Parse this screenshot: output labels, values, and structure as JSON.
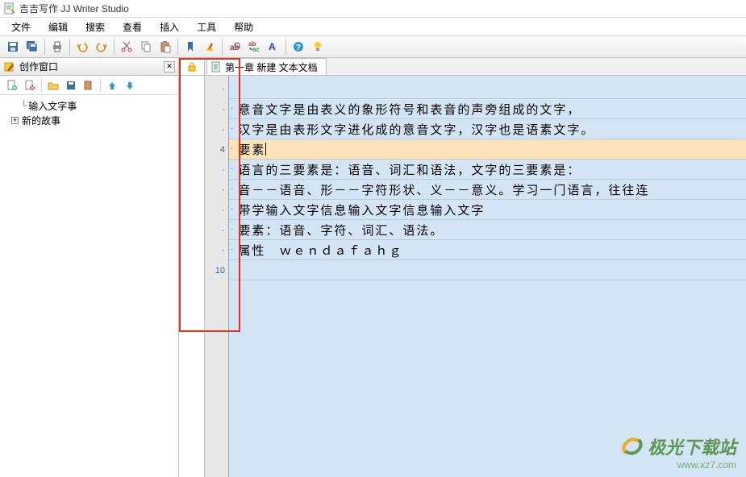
{
  "app": {
    "title": "吉吉写作 JJ Writer Studio"
  },
  "menus": [
    "文件",
    "编辑",
    "搜索",
    "查看",
    "插入",
    "工具",
    "帮助"
  ],
  "sidebar": {
    "title": "创作窗口",
    "tree": {
      "item1": "输入文字事",
      "item2": "新的故事"
    }
  },
  "tab": {
    "title": "第一章 新建 文本文档"
  },
  "editor": {
    "lines": [
      "",
      "意音文字是由表义的象形符号和表音的声旁组成的文字，",
      "汉字是由表形文字进化成的意音文字，汉字也是语素文字。",
      "要素",
      "语言的三要素是：语音、词汇和语法，文字的三要素是：",
      "音－－语音、形－－字符形状、义－－意义。学习一门语言，往往连",
      "带学输入文字信息输入文字信息输入文字",
      "要素：语音、字符、词汇、语法。",
      "属性　ｗｅｎｄａｆａｈｇ",
      ""
    ],
    "gutterNumbers": {
      "n4": "4",
      "n10": "10"
    }
  },
  "watermark": {
    "name": "极光下载站",
    "url": "www.xz7.com"
  }
}
